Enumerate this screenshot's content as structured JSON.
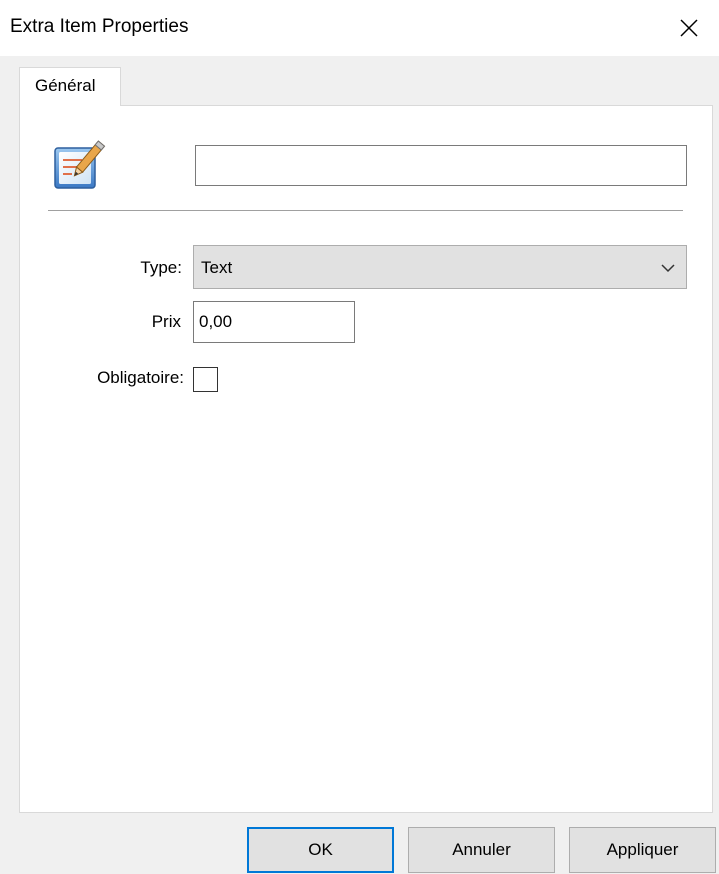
{
  "window": {
    "title": "Extra Item Properties",
    "close_icon": "close-icon"
  },
  "tabs": [
    {
      "label": "Général",
      "active": true
    }
  ],
  "general": {
    "icon": "edit-document-icon",
    "name_value": "",
    "type_label": "Type:",
    "type_value": "Text",
    "price_label": "Prix",
    "price_value": "0,00",
    "mandatory_label": "Obligatoire:",
    "mandatory_checked": false
  },
  "buttons": {
    "ok": "OK",
    "cancel": "Annuler",
    "apply": "Appliquer"
  },
  "colors": {
    "accent": "#0078d7",
    "button_bg": "#e1e1e1",
    "panel_bg": "#ffffff",
    "dialog_bg": "#f0f0f0"
  }
}
